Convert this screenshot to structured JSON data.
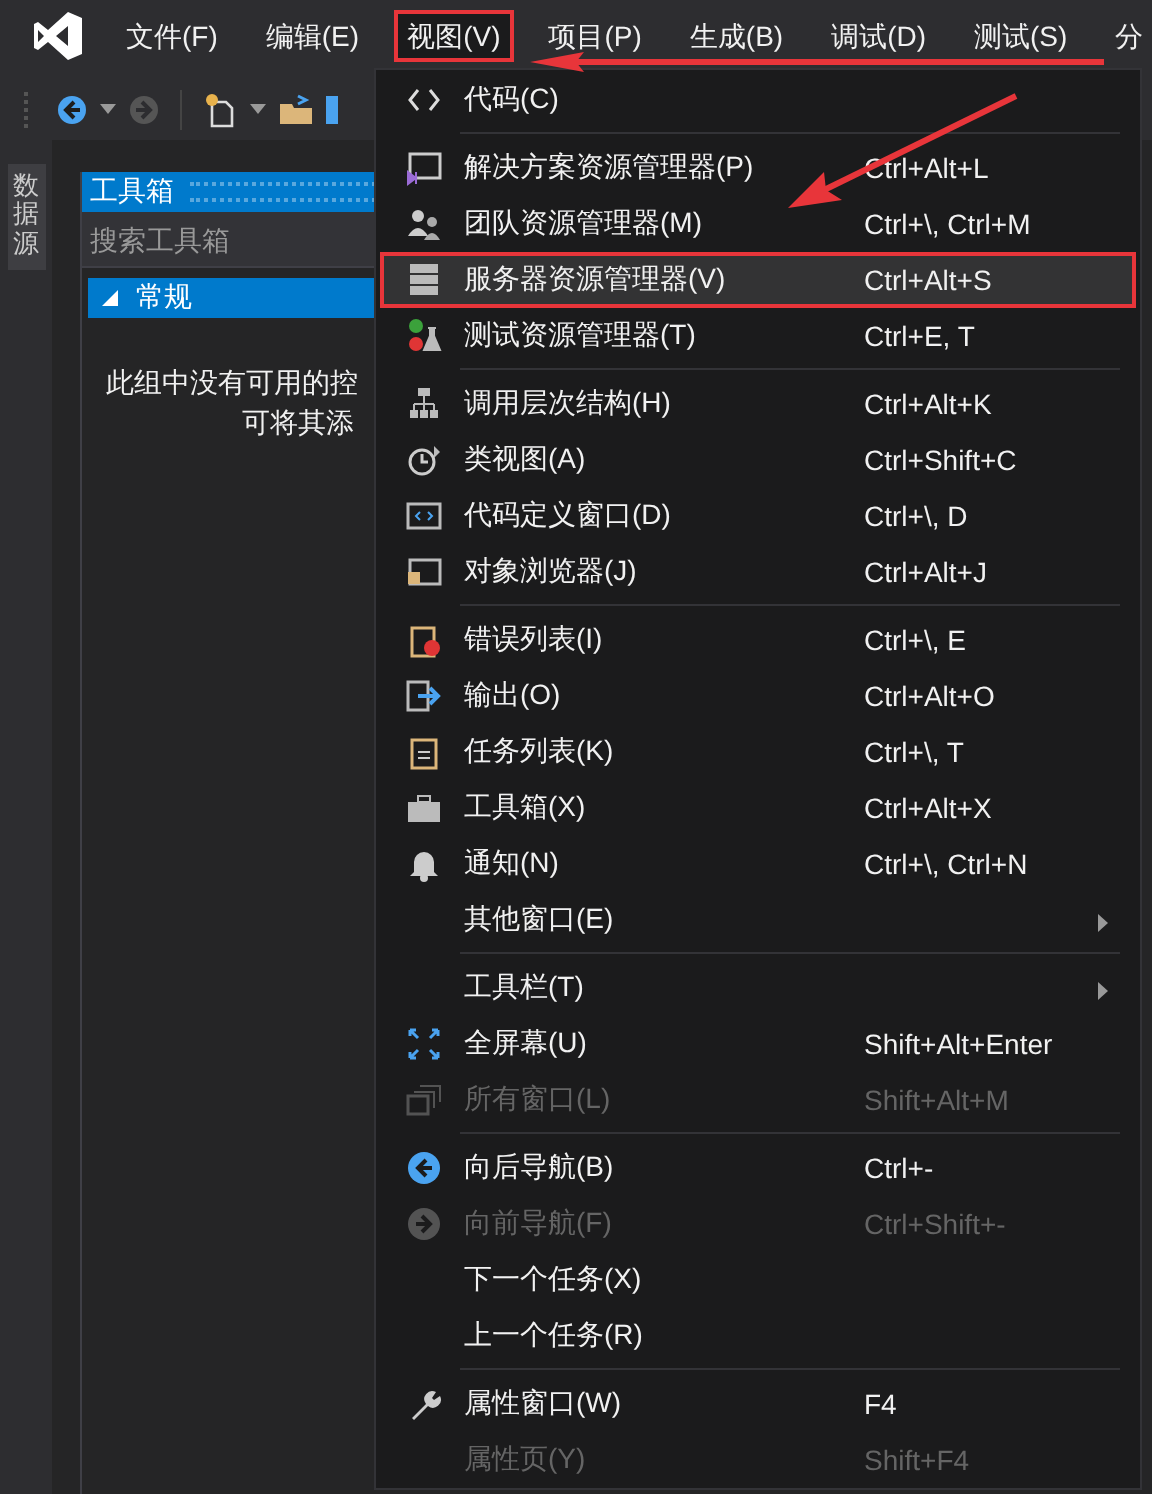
{
  "menu_bar": [
    {
      "label": "文件(F)",
      "selected": false
    },
    {
      "label": "编辑(E)",
      "selected": false
    },
    {
      "label": "视图(V)",
      "selected": true
    },
    {
      "label": "项目(P)",
      "selected": false
    },
    {
      "label": "生成(B)",
      "selected": false
    },
    {
      "label": "调试(D)",
      "selected": false
    },
    {
      "label": "测试(S)",
      "selected": false
    },
    {
      "label": "分",
      "selected": false
    }
  ],
  "side_tab": {
    "label": "数据源"
  },
  "toolbox": {
    "title": "工具箱",
    "search": {
      "placeholder": "搜索工具箱"
    },
    "group": {
      "label": "常规",
      "expanded": true
    },
    "empty_text_lines": [
      "此组中没有可用的控",
      "可将其添"
    ]
  },
  "view_menu": {
    "sections": [
      [
        {
          "label": "代码(C)",
          "disabled": false,
          "submenu": false,
          "selected": false
        }
      ],
      [
        {
          "label": "解决方案资源管理器(P)",
          "shortcut": "Ctrl+Alt+L",
          "disabled": false,
          "submenu": false,
          "selected": false
        },
        {
          "label": "团队资源管理器(M)",
          "shortcut": "Ctrl+\\, Ctrl+M",
          "disabled": false,
          "submenu": false,
          "selected": false
        },
        {
          "label": "服务器资源管理器(V)",
          "shortcut": "Ctrl+Alt+S",
          "disabled": false,
          "submenu": false,
          "selected": true
        },
        {
          "label": "测试资源管理器(T)",
          "shortcut": "Ctrl+E, T",
          "disabled": false,
          "submenu": false,
          "selected": false
        }
      ],
      [
        {
          "label": "调用层次结构(H)",
          "shortcut": "Ctrl+Alt+K",
          "disabled": false,
          "submenu": false,
          "selected": false
        },
        {
          "label": "类视图(A)",
          "shortcut": "Ctrl+Shift+C",
          "disabled": false,
          "submenu": false,
          "selected": false
        },
        {
          "label": "代码定义窗口(D)",
          "shortcut": "Ctrl+\\, D",
          "disabled": false,
          "submenu": false,
          "selected": false
        },
        {
          "label": "对象浏览器(J)",
          "shortcut": "Ctrl+Alt+J",
          "disabled": false,
          "submenu": false,
          "selected": false
        }
      ],
      [
        {
          "label": "错误列表(I)",
          "shortcut": "Ctrl+\\, E",
          "disabled": false,
          "submenu": false,
          "selected": false
        },
        {
          "label": "输出(O)",
          "shortcut": "Ctrl+Alt+O",
          "disabled": false,
          "submenu": false,
          "selected": false
        },
        {
          "label": "任务列表(K)",
          "shortcut": "Ctrl+\\, T",
          "disabled": false,
          "submenu": false,
          "selected": false
        },
        {
          "label": "工具箱(X)",
          "shortcut": "Ctrl+Alt+X",
          "disabled": false,
          "submenu": false,
          "selected": false
        },
        {
          "label": "通知(N)",
          "shortcut": "Ctrl+\\, Ctrl+N",
          "disabled": false,
          "submenu": false,
          "selected": false
        },
        {
          "label": "其他窗口(E)",
          "disabled": false,
          "submenu": true,
          "selected": false
        }
      ],
      [
        {
          "label": "工具栏(T)",
          "disabled": false,
          "submenu": true,
          "selected": false
        },
        {
          "label": "全屏幕(U)",
          "shortcut": "Shift+Alt+Enter",
          "disabled": false,
          "submenu": false,
          "selected": false
        },
        {
          "label": "所有窗口(L)",
          "shortcut": "Shift+Alt+M",
          "disabled": true,
          "submenu": false,
          "selected": false
        }
      ],
      [
        {
          "label": "向后导航(B)",
          "shortcut": "Ctrl+-",
          "disabled": false,
          "submenu": false,
          "selected": false
        },
        {
          "label": "向前导航(F)",
          "shortcut": "Ctrl+Shift+-",
          "disabled": true,
          "submenu": false,
          "selected": false
        },
        {
          "label": "下一个任务(X)",
          "disabled": false,
          "submenu": false,
          "selected": false
        },
        {
          "label": "上一个任务(R)",
          "disabled": false,
          "submenu": false,
          "selected": false
        }
      ],
      [
        {
          "label": "属性窗口(W)",
          "shortcut": "F4",
          "disabled": false,
          "submenu": false,
          "selected": false
        },
        {
          "label": "属性页(Y)",
          "shortcut": "Shift+F4",
          "disabled": true,
          "submenu": false,
          "selected": false
        }
      ]
    ]
  }
}
